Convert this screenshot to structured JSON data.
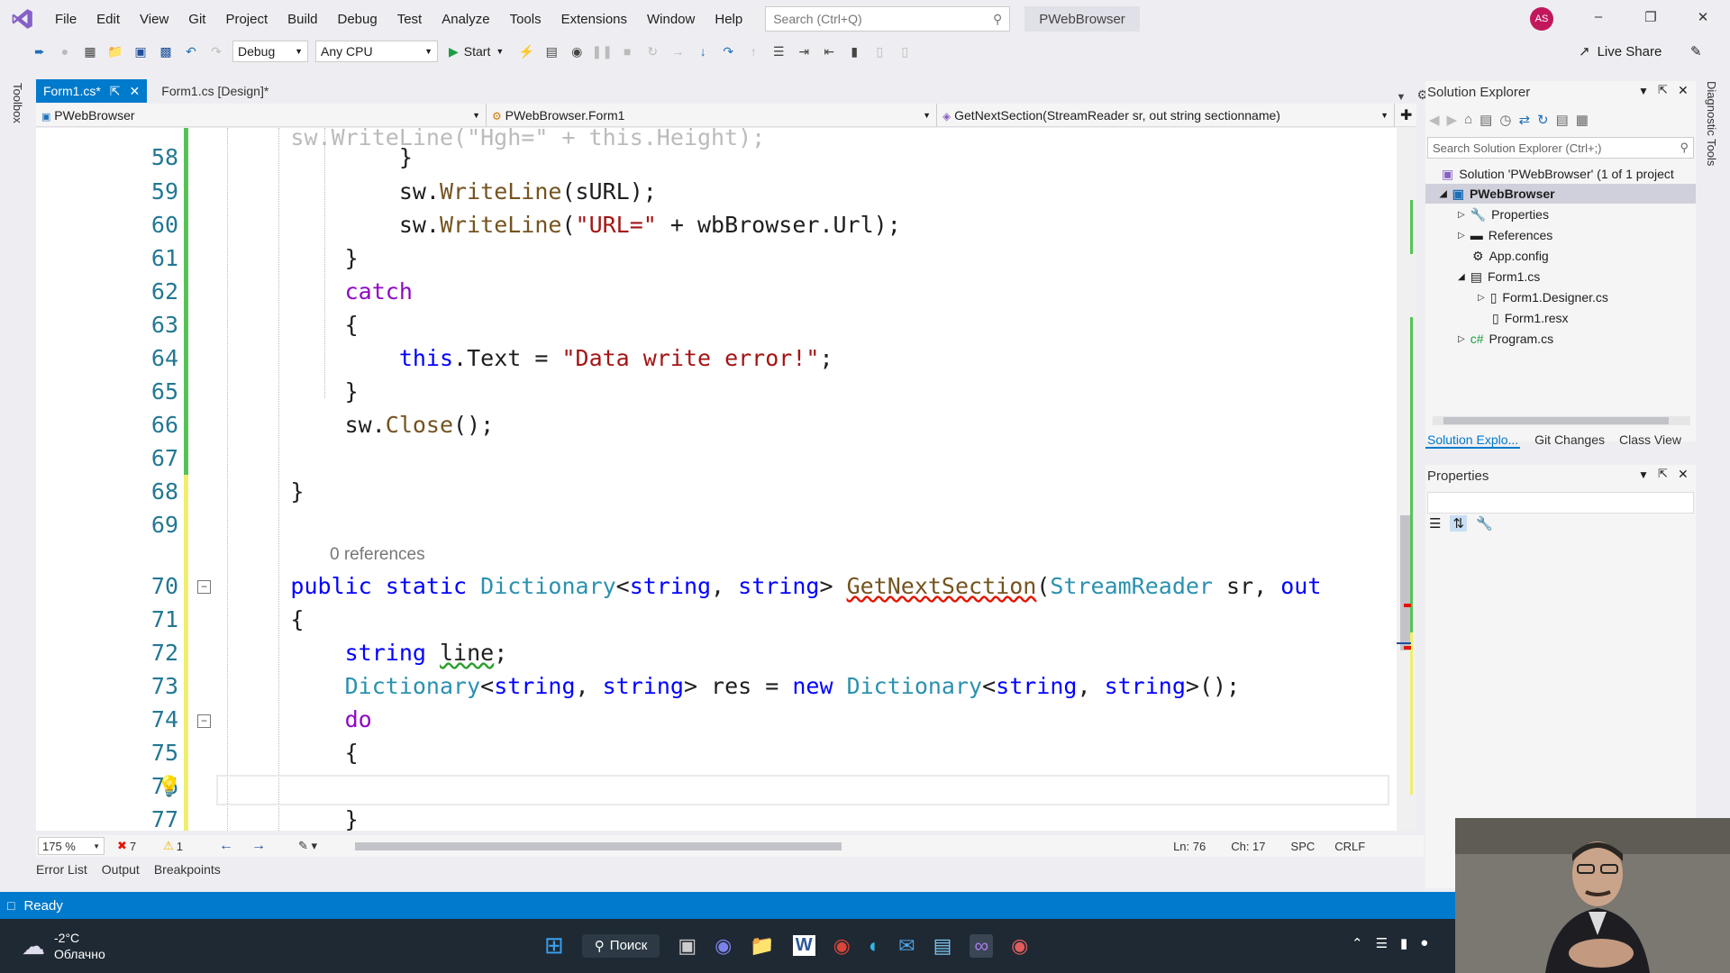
{
  "menubar": {
    "items": [
      "File",
      "Edit",
      "View",
      "Git",
      "Project",
      "Build",
      "Debug",
      "Test",
      "Analyze",
      "Tools",
      "Extensions",
      "Window",
      "Help"
    ],
    "search_placeholder": "Search (Ctrl+Q)",
    "solution_name": "PWebBrowser",
    "avatar_initials": "AS"
  },
  "toolbar": {
    "config": "Debug",
    "platform": "Any CPU",
    "start_label": "Start",
    "live_share": "Live Share"
  },
  "side_strips": {
    "toolbox": "Toolbox",
    "diagnostic": "Diagnostic Tools"
  },
  "tabs": [
    {
      "label": "Form1.cs*"
    },
    {
      "label": "Form1.cs [Design]*"
    }
  ],
  "navbar": {
    "project": "PWebBrowser",
    "class": "PWebBrowser.Form1",
    "member": "GetNextSection(StreamReader sr, out string sectionname)"
  },
  "code": {
    "references_label": "0 references",
    "line_numbers": [
      "58",
      "59",
      "60",
      "61",
      "62",
      "63",
      "64",
      "65",
      "66",
      "67",
      "68",
      "69",
      "70",
      "71",
      "72",
      "73",
      "74",
      "75",
      "76",
      "77"
    ]
  },
  "editor_status": {
    "zoom": "175 %",
    "errors": "7",
    "warnings": "1",
    "ln": "Ln: 76",
    "ch": "Ch: 17",
    "spc": "SPC",
    "crlf": "CRLF"
  },
  "bottom_tabs": [
    "Error List",
    "Output",
    "Breakpoints"
  ],
  "statusbar": {
    "text": "Ready"
  },
  "solution_explorer": {
    "title": "Solution Explorer",
    "search_placeholder": "Search Solution Explorer (Ctrl+;)",
    "solution_label": "Solution 'PWebBrowser' (1 of 1 project",
    "items": [
      {
        "label": "PWebBrowser",
        "icon": "project-icon"
      },
      {
        "label": "Properties",
        "icon": "wrench-icon"
      },
      {
        "label": "References",
        "icon": "references-icon"
      },
      {
        "label": "App.config",
        "icon": "config-icon"
      },
      {
        "label": "Form1.cs",
        "icon": "form-icon"
      },
      {
        "label": "Form1.Designer.cs",
        "icon": "cs-file-icon"
      },
      {
        "label": "Form1.resx",
        "icon": "resx-icon"
      },
      {
        "label": "Program.cs",
        "icon": "cs-file-icon"
      }
    ],
    "bottom_tabs": [
      "Solution Explo...",
      "Git Changes",
      "Class View"
    ]
  },
  "properties_panel": {
    "title": "Properties"
  },
  "taskbar": {
    "weather_temp": "-2°C",
    "weather_desc": "Облачно",
    "search_label": "Поиск"
  },
  "colors": {
    "accent": "#007acc",
    "keyword": "#0000ff",
    "type": "#2b91af",
    "string": "#a31515"
  }
}
